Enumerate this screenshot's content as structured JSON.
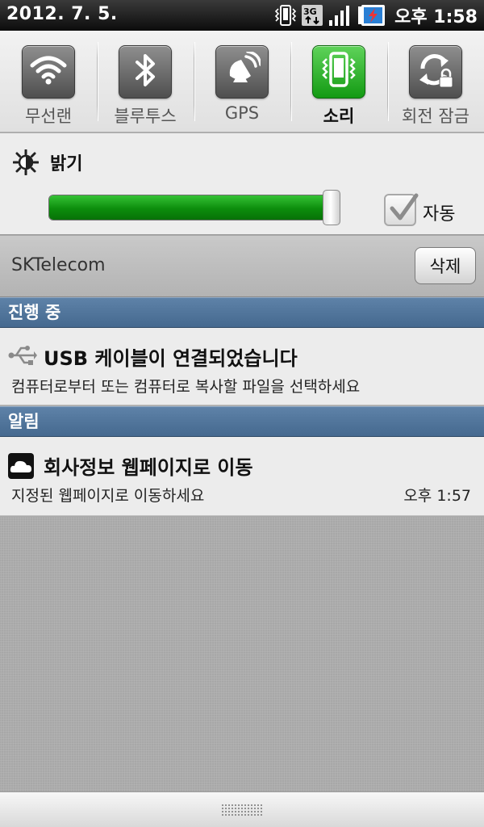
{
  "status_bar": {
    "date": "2012. 7. 5.",
    "time": "오후 1:58",
    "icons": [
      "vibrate-icon",
      "3g-data-icon",
      "signal-icon",
      "battery-charging-icon"
    ]
  },
  "quick_settings": {
    "items": [
      {
        "label": "무선랜",
        "icon": "wifi-icon",
        "active": false
      },
      {
        "label": "블루투스",
        "icon": "bluetooth-icon",
        "active": false
      },
      {
        "label": "GPS",
        "icon": "gps-icon",
        "active": false
      },
      {
        "label": "소리",
        "icon": "vibrate-phone-icon",
        "active": true
      },
      {
        "label": "회전 잠금",
        "icon": "rotation-lock-icon",
        "active": false
      }
    ],
    "active_color": "#1fa81f"
  },
  "brightness": {
    "title": "밝기",
    "level_percent": 97,
    "auto_label": "자동",
    "auto_checked": true
  },
  "carrier": {
    "name": "SKTelecom",
    "clear_label": "삭제"
  },
  "sections": {
    "ongoing": {
      "header": "진행 중",
      "notification": {
        "icon": "usb-icon",
        "title": "USB 케이블이 연결되었습니다",
        "text": "컴퓨터로부터 또는 컴퓨터로 복사할 파일을 선택하세요"
      }
    },
    "alerts": {
      "header": "알림",
      "notification": {
        "icon": "cloud-icon",
        "title": "회사정보 웹페이지로 이동",
        "text": "지정된 웹페이지로 이동하세요",
        "time": "오후 1:57"
      }
    }
  },
  "colors": {
    "section_header": "#52769c",
    "toggle_off": "#6a6a6a",
    "slider_fill": "#1a9e1a"
  }
}
